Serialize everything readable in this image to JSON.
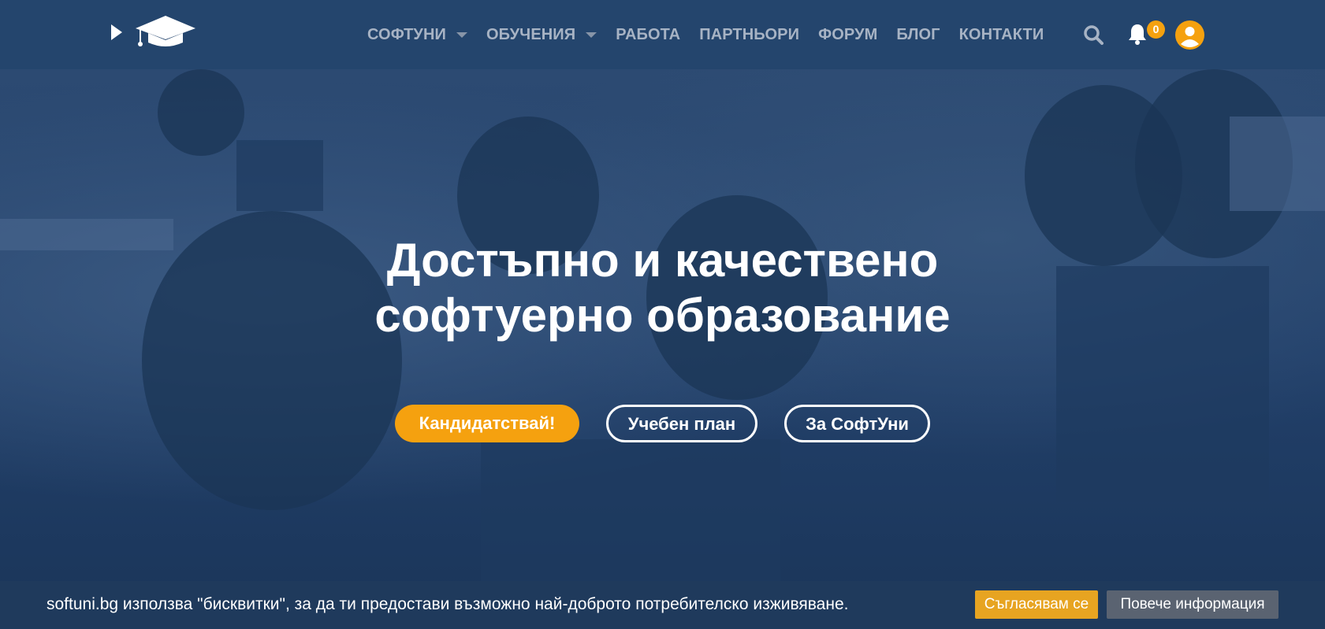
{
  "header": {
    "logo_icon": "graduation-cap-logo",
    "play_icon": "play-arrow-icon",
    "nav": [
      {
        "label": "СОФТУНИ",
        "has_dropdown": true
      },
      {
        "label": "ОБУЧЕНИЯ",
        "has_dropdown": true
      },
      {
        "label": "РАБОТА",
        "has_dropdown": false
      },
      {
        "label": "ПАРТНЬОРИ",
        "has_dropdown": false
      },
      {
        "label": "ФОРУМ",
        "has_dropdown": false
      },
      {
        "label": "БЛОГ",
        "has_dropdown": false
      },
      {
        "label": "КОНТАКТИ",
        "has_dropdown": false
      }
    ],
    "search_icon": "search-icon",
    "notifications": {
      "icon": "bell-icon",
      "count": "0"
    },
    "avatar_icon": "user-avatar-icon"
  },
  "hero": {
    "title_line1": "Достъпно и качествено",
    "title_line2": "софтуерно образование",
    "buttons": {
      "apply": "Кандидатствай!",
      "curriculum": "Учебен план",
      "about": "За СофтУни"
    }
  },
  "cookie_bar": {
    "text": "softuni.bg използва \"бисквитки\", за да ти предостави възможно най-доброто потребителско изживяване.",
    "accept": "Съгласявам се",
    "more": "Повече информация"
  },
  "colors": {
    "header_bg": "#24456d",
    "nav_text": "#a7b3c4",
    "accent": "#f5a10f",
    "cookie_accept": "#e7a421",
    "cookie_more": "#5a6371"
  }
}
